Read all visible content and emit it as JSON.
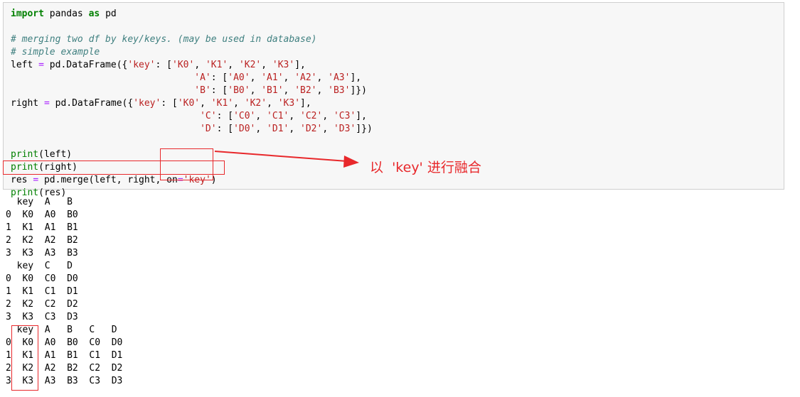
{
  "code_cell": {
    "lines": [
      [
        {
          "t": "import",
          "c": "k"
        },
        {
          "t": " pandas ",
          "c": ""
        },
        {
          "t": "as",
          "c": "k"
        },
        {
          "t": " pd",
          "c": ""
        }
      ],
      [],
      [
        {
          "t": "# merging two df by key/keys. (may be used in database)",
          "c": "c"
        }
      ],
      [
        {
          "t": "# simple example",
          "c": "c"
        }
      ],
      [
        {
          "t": "left ",
          "c": ""
        },
        {
          "t": "=",
          "c": "o"
        },
        {
          "t": " pd.DataFrame({",
          "c": ""
        },
        {
          "t": "'key'",
          "c": "s"
        },
        {
          "t": ": [",
          "c": ""
        },
        {
          "t": "'K0'",
          "c": "s"
        },
        {
          "t": ", ",
          "c": ""
        },
        {
          "t": "'K1'",
          "c": "s"
        },
        {
          "t": ", ",
          "c": ""
        },
        {
          "t": "'K2'",
          "c": "s"
        },
        {
          "t": ", ",
          "c": ""
        },
        {
          "t": "'K3'",
          "c": "s"
        },
        {
          "t": "],",
          "c": ""
        }
      ],
      [
        {
          "t": "                                 ",
          "c": ""
        },
        {
          "t": "'A'",
          "c": "s"
        },
        {
          "t": ": [",
          "c": ""
        },
        {
          "t": "'A0'",
          "c": "s"
        },
        {
          "t": ", ",
          "c": ""
        },
        {
          "t": "'A1'",
          "c": "s"
        },
        {
          "t": ", ",
          "c": ""
        },
        {
          "t": "'A2'",
          "c": "s"
        },
        {
          "t": ", ",
          "c": ""
        },
        {
          "t": "'A3'",
          "c": "s"
        },
        {
          "t": "],",
          "c": ""
        }
      ],
      [
        {
          "t": "                                 ",
          "c": ""
        },
        {
          "t": "'B'",
          "c": "s"
        },
        {
          "t": ": [",
          "c": ""
        },
        {
          "t": "'B0'",
          "c": "s"
        },
        {
          "t": ", ",
          "c": ""
        },
        {
          "t": "'B1'",
          "c": "s"
        },
        {
          "t": ", ",
          "c": ""
        },
        {
          "t": "'B2'",
          "c": "s"
        },
        {
          "t": ", ",
          "c": ""
        },
        {
          "t": "'B3'",
          "c": "s"
        },
        {
          "t": "]})",
          "c": ""
        }
      ],
      [
        {
          "t": "right ",
          "c": ""
        },
        {
          "t": "=",
          "c": "o"
        },
        {
          "t": " pd.DataFrame({",
          "c": ""
        },
        {
          "t": "'key'",
          "c": "s"
        },
        {
          "t": ": [",
          "c": ""
        },
        {
          "t": "'K0'",
          "c": "s"
        },
        {
          "t": ", ",
          "c": ""
        },
        {
          "t": "'K1'",
          "c": "s"
        },
        {
          "t": ", ",
          "c": ""
        },
        {
          "t": "'K2'",
          "c": "s"
        },
        {
          "t": ", ",
          "c": ""
        },
        {
          "t": "'K3'",
          "c": "s"
        },
        {
          "t": "],",
          "c": ""
        }
      ],
      [
        {
          "t": "                                  ",
          "c": ""
        },
        {
          "t": "'C'",
          "c": "s"
        },
        {
          "t": ": [",
          "c": ""
        },
        {
          "t": "'C0'",
          "c": "s"
        },
        {
          "t": ", ",
          "c": ""
        },
        {
          "t": "'C1'",
          "c": "s"
        },
        {
          "t": ", ",
          "c": ""
        },
        {
          "t": "'C2'",
          "c": "s"
        },
        {
          "t": ", ",
          "c": ""
        },
        {
          "t": "'C3'",
          "c": "s"
        },
        {
          "t": "],",
          "c": ""
        }
      ],
      [
        {
          "t": "                                  ",
          "c": ""
        },
        {
          "t": "'D'",
          "c": "s"
        },
        {
          "t": ": [",
          "c": ""
        },
        {
          "t": "'D0'",
          "c": "s"
        },
        {
          "t": ", ",
          "c": ""
        },
        {
          "t": "'D1'",
          "c": "s"
        },
        {
          "t": ", ",
          "c": ""
        },
        {
          "t": "'D2'",
          "c": "s"
        },
        {
          "t": ", ",
          "c": ""
        },
        {
          "t": "'D3'",
          "c": "s"
        },
        {
          "t": "]})",
          "c": ""
        }
      ],
      [],
      [
        {
          "t": "print",
          "c": "b"
        },
        {
          "t": "(left)",
          "c": ""
        }
      ],
      [
        {
          "t": "print",
          "c": "b"
        },
        {
          "t": "(right)",
          "c": ""
        }
      ],
      [
        {
          "t": "res ",
          "c": ""
        },
        {
          "t": "=",
          "c": "o"
        },
        {
          "t": " pd.merge(left, right, on",
          "c": ""
        },
        {
          "t": "=",
          "c": "o"
        },
        {
          "t": "'key'",
          "c": "s"
        },
        {
          "t": ")",
          "c": ""
        }
      ],
      [
        {
          "t": "print",
          "c": "b"
        },
        {
          "t": "(res)",
          "c": ""
        }
      ]
    ]
  },
  "output": {
    "lines": [
      "  key  A   B",
      "0  K0  A0  B0",
      "1  K1  A1  B1",
      "2  K2  A2  B2",
      "3  K3  A3  B3",
      "  key  C   D",
      "0  K0  C0  D0",
      "1  K1  C1  D1",
      "2  K2  C2  D2",
      "3  K3  C3  D3",
      "  key  A   B   C   D",
      "0  K0  A0  B0  C0  D0",
      "1  K1  A1  B1  C1  D1",
      "2  K2  A2  B2  C2  D2",
      "3  K3  A3  B3  C3  D3"
    ]
  },
  "annotation": {
    "text": "以  'key' 进行融合",
    "color": "#e8282b"
  }
}
